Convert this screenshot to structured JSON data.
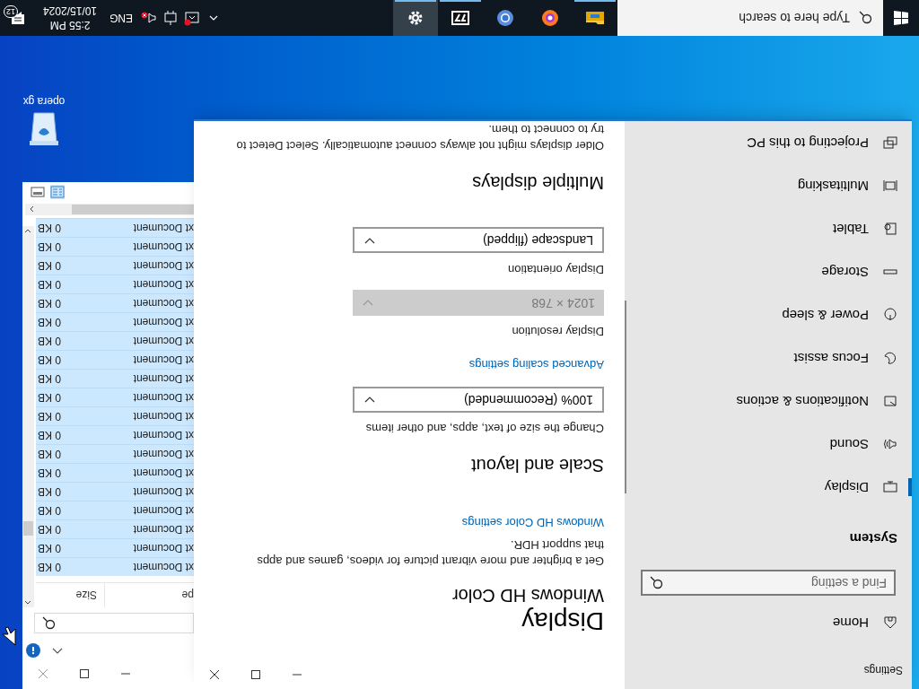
{
  "desktop": {
    "icons": [
      {
        "label": "opera gx"
      }
    ]
  },
  "settings_window": {
    "title": "Settings",
    "nav": {
      "home": "Home",
      "search_placeholder": "Find a setting",
      "section": "System",
      "items": [
        {
          "label": "Display",
          "selected": true
        },
        {
          "label": "Sound",
          "selected": false
        },
        {
          "label": "Notifications & actions",
          "selected": false
        },
        {
          "label": "Focus assist",
          "selected": false
        },
        {
          "label": "Power & sleep",
          "selected": false
        },
        {
          "label": "Storage",
          "selected": false
        },
        {
          "label": "Tablet",
          "selected": false
        },
        {
          "label": "Multitasking",
          "selected": false
        },
        {
          "label": "Projecting to this PC",
          "selected": false
        }
      ]
    },
    "page": {
      "title": "Display",
      "content": [
        {
          "kind": "subheading",
          "text": "Windows HD Color"
        },
        {
          "kind": "text",
          "text": "Get a brighter and more vibrant picture for videos, games and apps that support HDR."
        },
        {
          "kind": "link",
          "text": "Windows HD Color settings"
        },
        {
          "kind": "heading",
          "text": "Scale and layout"
        },
        {
          "kind": "label",
          "text": "Change the size of text, apps, and other items"
        },
        {
          "kind": "dropdown",
          "value": "100% (Recommended)",
          "disabled": false
        },
        {
          "kind": "link",
          "text": "Advanced scaling settings"
        },
        {
          "kind": "label",
          "text": "Display resolution"
        },
        {
          "kind": "dropdown",
          "value": "1024 × 768",
          "disabled": true
        },
        {
          "kind": "label",
          "text": "Display orientation"
        },
        {
          "kind": "dropdown",
          "value": "Landscape (flipped)",
          "disabled": false
        },
        {
          "kind": "heading",
          "text": "Multiple displays"
        },
        {
          "kind": "text",
          "text": "Older displays might not always connect automatically. Select Detect to try to connect to them."
        }
      ]
    }
  },
  "explorer": {
    "columns": [
      "pe",
      "Size"
    ],
    "rows": [
      {
        "type": "xt Document",
        "size": "0 KB",
        "selected": true
      },
      {
        "type": "xt Document",
        "size": "0 KB",
        "selected": true
      },
      {
        "type": "xt Document",
        "size": "0 KB",
        "selected": true
      },
      {
        "type": "xt Document",
        "size": "0 KB",
        "selected": true
      },
      {
        "type": "xt Document",
        "size": "0 KB",
        "selected": true
      },
      {
        "type": "xt Document",
        "size": "0 KB",
        "selected": true
      },
      {
        "type": "xt Document",
        "size": "0 KB",
        "selected": true
      },
      {
        "type": "xt Document",
        "size": "0 KB",
        "selected": true
      },
      {
        "type": "xt Document",
        "size": "0 KB",
        "selected": true
      },
      {
        "type": "xt Document",
        "size": "0 KB",
        "selected": true
      },
      {
        "type": "xt Document",
        "size": "0 KB",
        "selected": true
      },
      {
        "type": "xt Document",
        "size": "0 KB",
        "selected": true
      },
      {
        "type": "xt Document",
        "size": "0 KB",
        "selected": true
      },
      {
        "type": "xt Document",
        "size": "0 KB",
        "selected": true
      },
      {
        "type": "xt Document",
        "size": "0 KB",
        "selected": true
      },
      {
        "type": "xt Document",
        "size": "0 KB",
        "selected": true
      },
      {
        "type": "xt Document",
        "size": "0 KB",
        "selected": true
      },
      {
        "type": "xt Document",
        "size": "0 KB",
        "selected": true
      },
      {
        "type": "xt Document",
        "size": "0 KB",
        "selected": true
      }
    ]
  },
  "taskbar": {
    "search_placeholder": "Type here to search",
    "apps": [
      {
        "kind": "folder",
        "running": true,
        "selected": false
      },
      {
        "kind": "browser-orange",
        "running": false,
        "selected": false
      },
      {
        "kind": "browser-blue",
        "running": false,
        "selected": false
      },
      {
        "kind": "archive",
        "running": true,
        "selected": false
      },
      {
        "kind": "settings",
        "running": true,
        "selected": true
      }
    ],
    "tray": {
      "volume_muted": true,
      "language": "ENG",
      "time": "2:55 PM",
      "date": "10/15/2024",
      "notifications": "12"
    }
  }
}
